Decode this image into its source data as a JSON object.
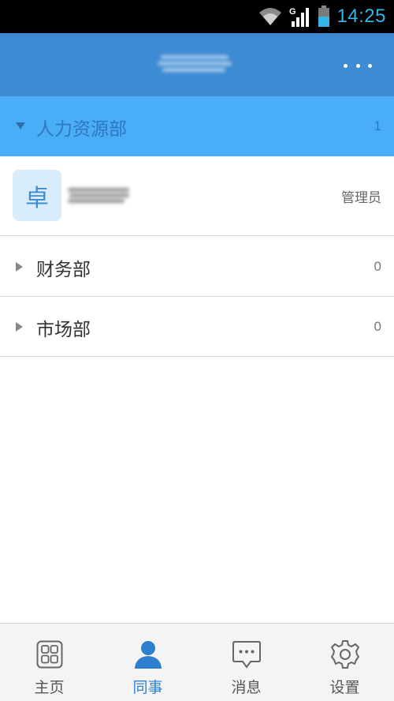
{
  "status_bar": {
    "time": "14:25",
    "network_type": "G",
    "icons": [
      "wifi-icon",
      "signal-icon",
      "battery-icon"
    ],
    "time_color": "#33b5e5"
  },
  "header": {
    "title": "",
    "more_icon": "overflow-menu-icon",
    "background": "#3d8bd3"
  },
  "groups": [
    {
      "name": "人力资源部",
      "count": "1",
      "expanded": true,
      "members": [
        {
          "avatar_text": "卓",
          "name": "",
          "role": "管理员"
        }
      ]
    },
    {
      "name": "财务部",
      "count": "0",
      "expanded": false
    },
    {
      "name": "市场部",
      "count": "0",
      "expanded": false
    }
  ],
  "bottom_nav": {
    "items": [
      {
        "label": "主页",
        "icon": "home-grid-icon",
        "active": false
      },
      {
        "label": "同事",
        "icon": "person-icon",
        "active": true
      },
      {
        "label": "消息",
        "icon": "chat-bubble-icon",
        "active": false
      },
      {
        "label": "设置",
        "icon": "gear-icon",
        "active": false
      }
    ],
    "active_color": "#2f7fd0"
  }
}
